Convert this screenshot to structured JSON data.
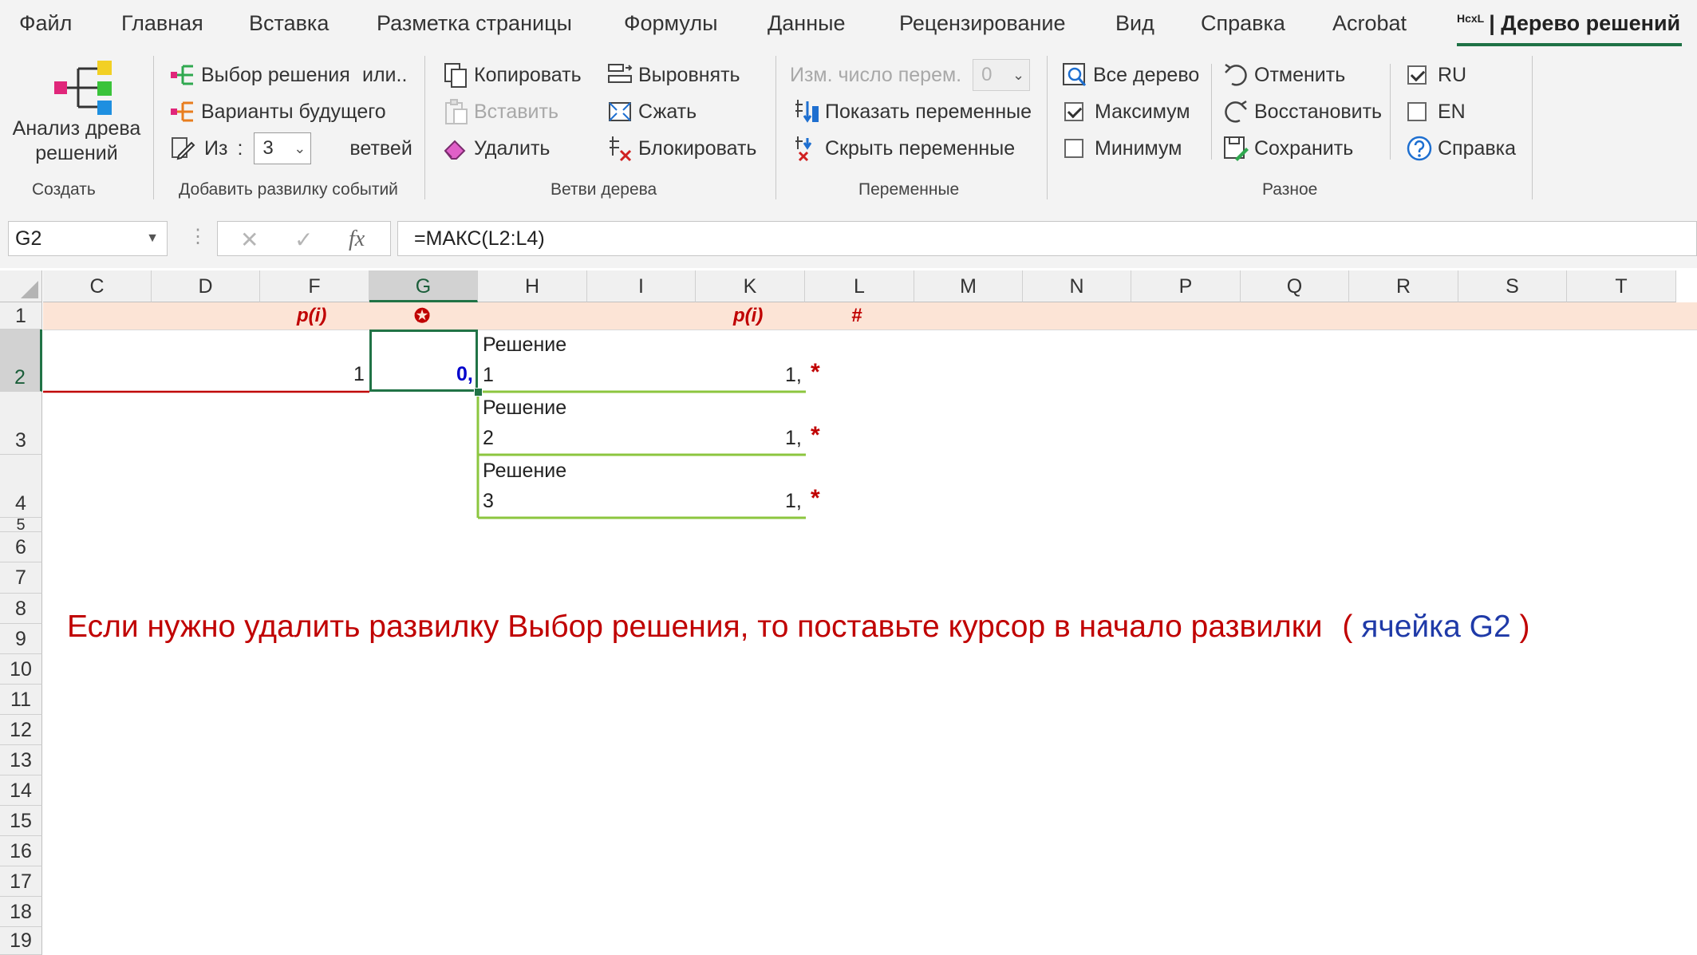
{
  "menu": {
    "tabs": [
      "Файл",
      "Главная",
      "Вставка",
      "Разметка страницы",
      "Формулы",
      "Данные",
      "Рецензирование",
      "Вид",
      "Справка",
      "Acrobat"
    ],
    "active_tab_prefix": "HcxL",
    "active_tab": "| Дерево решений"
  },
  "ribbon": {
    "create": {
      "button": "Анализ древа\nрешений",
      "group": "Создать"
    },
    "fork": {
      "choose_decision": "Выбор решения",
      "or": "или..",
      "future_variants": "Варианты будущего",
      "from_label": "Из",
      "colon": ":",
      "branches_count": "3",
      "branches_label": "ветвей",
      "group": "Добавить развилку событий"
    },
    "branches": {
      "copy": "Копировать",
      "paste": "Вставить",
      "delete": "Удалить",
      "align": "Выровнять",
      "compress": "Сжать",
      "block": "Блокировать",
      "group": "Ветви дерева"
    },
    "variables": {
      "change_count_label": "Изм. число перем.",
      "change_count_value": "0",
      "show": "Показать переменные",
      "hide": "Скрыть переменные",
      "group": "Переменные"
    },
    "misc": {
      "whole_tree": "Все дерево",
      "maximum": "Максимум",
      "minimum": "Минимум",
      "undo": "Отменить",
      "redo": "Восстановить",
      "save": "Сохранить",
      "ru": "RU",
      "en": "EN",
      "help": "Справка",
      "group": "Разное",
      "maximum_checked": true,
      "minimum_checked": false,
      "ru_checked": true,
      "en_checked": false
    }
  },
  "formula_bar": {
    "name_box": "G2",
    "cancel": "✕",
    "enter": "✓",
    "fx": "fx",
    "formula": "=МАКС(L2:L4)"
  },
  "sheet": {
    "columns": [
      "C",
      "D",
      "F",
      "G",
      "H",
      "I",
      "K",
      "L",
      "M",
      "N",
      "P",
      "Q",
      "R",
      "S",
      "T"
    ],
    "selected_column": "G",
    "rows": [
      "1",
      "2",
      "3",
      "4",
      "5",
      "6",
      "7",
      "8",
      "9",
      "10",
      "11",
      "12",
      "13",
      "14",
      "15",
      "16",
      "17",
      "18",
      "19"
    ],
    "selected_row": "2",
    "row1": {
      "p_left": "p(i)",
      "gear": "✪",
      "p_right": "p(i)",
      "hash": "#"
    },
    "f2_value": "1",
    "g2_value": "0,",
    "decisions": [
      {
        "title": "Решение",
        "number": "1",
        "value": "1,",
        "marker": "*"
      },
      {
        "title": "Решение",
        "number": "2",
        "value": "1,",
        "marker": "*"
      },
      {
        "title": "Решение",
        "number": "3",
        "value": "1,",
        "marker": "*"
      }
    ],
    "note_main": "Если нужно удалить развилку Выбор решения, то поставьте курсор в начало развилки",
    "note_open": "(",
    "note_cell": "ячейка G2",
    "note_close": ")"
  },
  "colors": {
    "excel_green": "#217346",
    "branch_red": "#c00000",
    "branch_green": "#8cc63f",
    "value_blue": "#0000cc",
    "row1_fill": "#fce4d6"
  }
}
